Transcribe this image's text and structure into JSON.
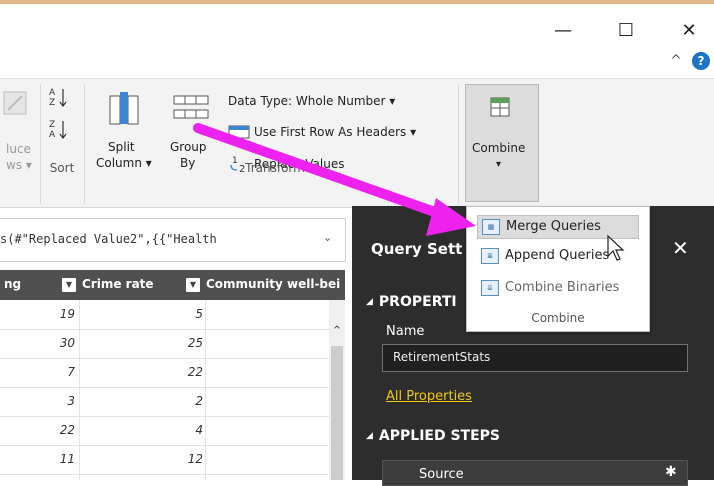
{
  "window": {
    "minimize_glyph": "—",
    "maximize_glyph": "☐",
    "close_glyph": "✕",
    "collapse_glyph": "^",
    "help_glyph": "?"
  },
  "ribbon": {
    "reduce_label_1": "luce",
    "reduce_label_2": "ws ▾",
    "sort_group": "Sort",
    "split_column_1": "Split",
    "split_column_2": "Column ▾",
    "group_by_1": "Group",
    "group_by_2": "By",
    "data_type": "Data Type: Whole Number ▾",
    "first_row_headers": "Use First Row As Headers ▾",
    "replace_values": "Replace Values",
    "transform_group": "Transform",
    "combine_label": "Combine",
    "combine_arrow": "▾"
  },
  "formula_bar": {
    "text": "s(#\"Replaced Value2\",{{\"Health",
    "expand_glyph": "⌄"
  },
  "table": {
    "columns": [
      "ng",
      "Crime rate",
      "Community well-bei"
    ],
    "rows": [
      {
        "a": "19",
        "b": "5"
      },
      {
        "a": "30",
        "b": "25"
      },
      {
        "a": "7",
        "b": "22"
      },
      {
        "a": "3",
        "b": "2"
      },
      {
        "a": "22",
        "b": "4"
      },
      {
        "a": "11",
        "b": "12"
      }
    ]
  },
  "query_settings": {
    "title": "Query Sett",
    "close_glyph": "✕",
    "properties_heading": "PROPERTI",
    "name_label": "Name",
    "name_value": "RetirementStats",
    "all_properties": "All Properties",
    "applied_steps_heading": "APPLIED STEPS",
    "steps": [
      "Source"
    ]
  },
  "combine_menu": {
    "items": [
      {
        "label": "Merge Queries",
        "highlighted": true
      },
      {
        "label": "Append Queries",
        "highlighted": false
      },
      {
        "label": "Combine Binaries",
        "highlighted": false,
        "disabled": true
      }
    ],
    "footer": "Combine"
  },
  "colors": {
    "arrow": "#ee22ee",
    "panel_bg": "#2d2d2d",
    "header_bg": "#505050",
    "link": "#f2c811"
  },
  "icons": [
    "sort-asc-icon",
    "sort-desc-icon",
    "split-column-icon",
    "group-by-icon",
    "first-row-headers-icon",
    "replace-values-icon",
    "combine-icon",
    "merge-queries-icon",
    "append-queries-icon",
    "combine-binaries-icon",
    "filter-icon",
    "gear-icon",
    "mouse-pointer-icon",
    "annotation-arrow"
  ]
}
